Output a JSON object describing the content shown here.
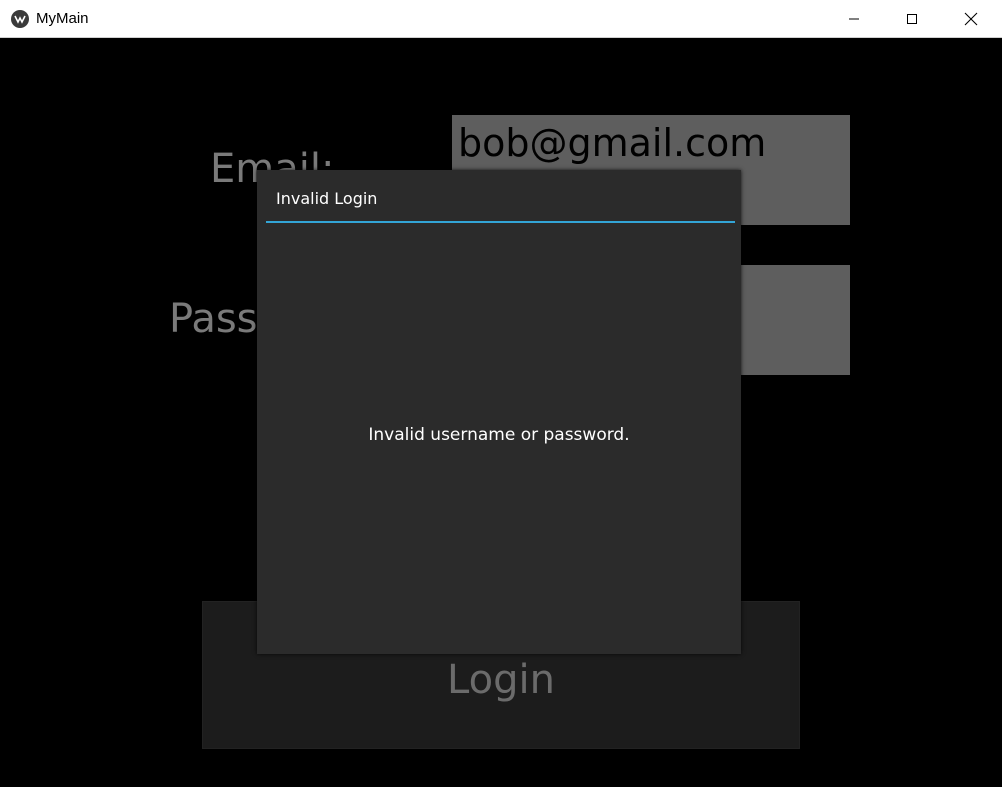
{
  "window": {
    "title": "MyMain",
    "icon": "kivy-logo-icon"
  },
  "form": {
    "email_label": "Email:",
    "email_value": "bob@gmail.com",
    "password_label": "Password:",
    "password_value": "",
    "login_label": "Login"
  },
  "popup": {
    "title": "Invalid Login",
    "message": "Invalid username or password.",
    "separator_color": "#33a5d6"
  },
  "colors": {
    "background": "#000000",
    "popup_background": "#2b2b2b",
    "field_background": "#5e5e5e"
  }
}
